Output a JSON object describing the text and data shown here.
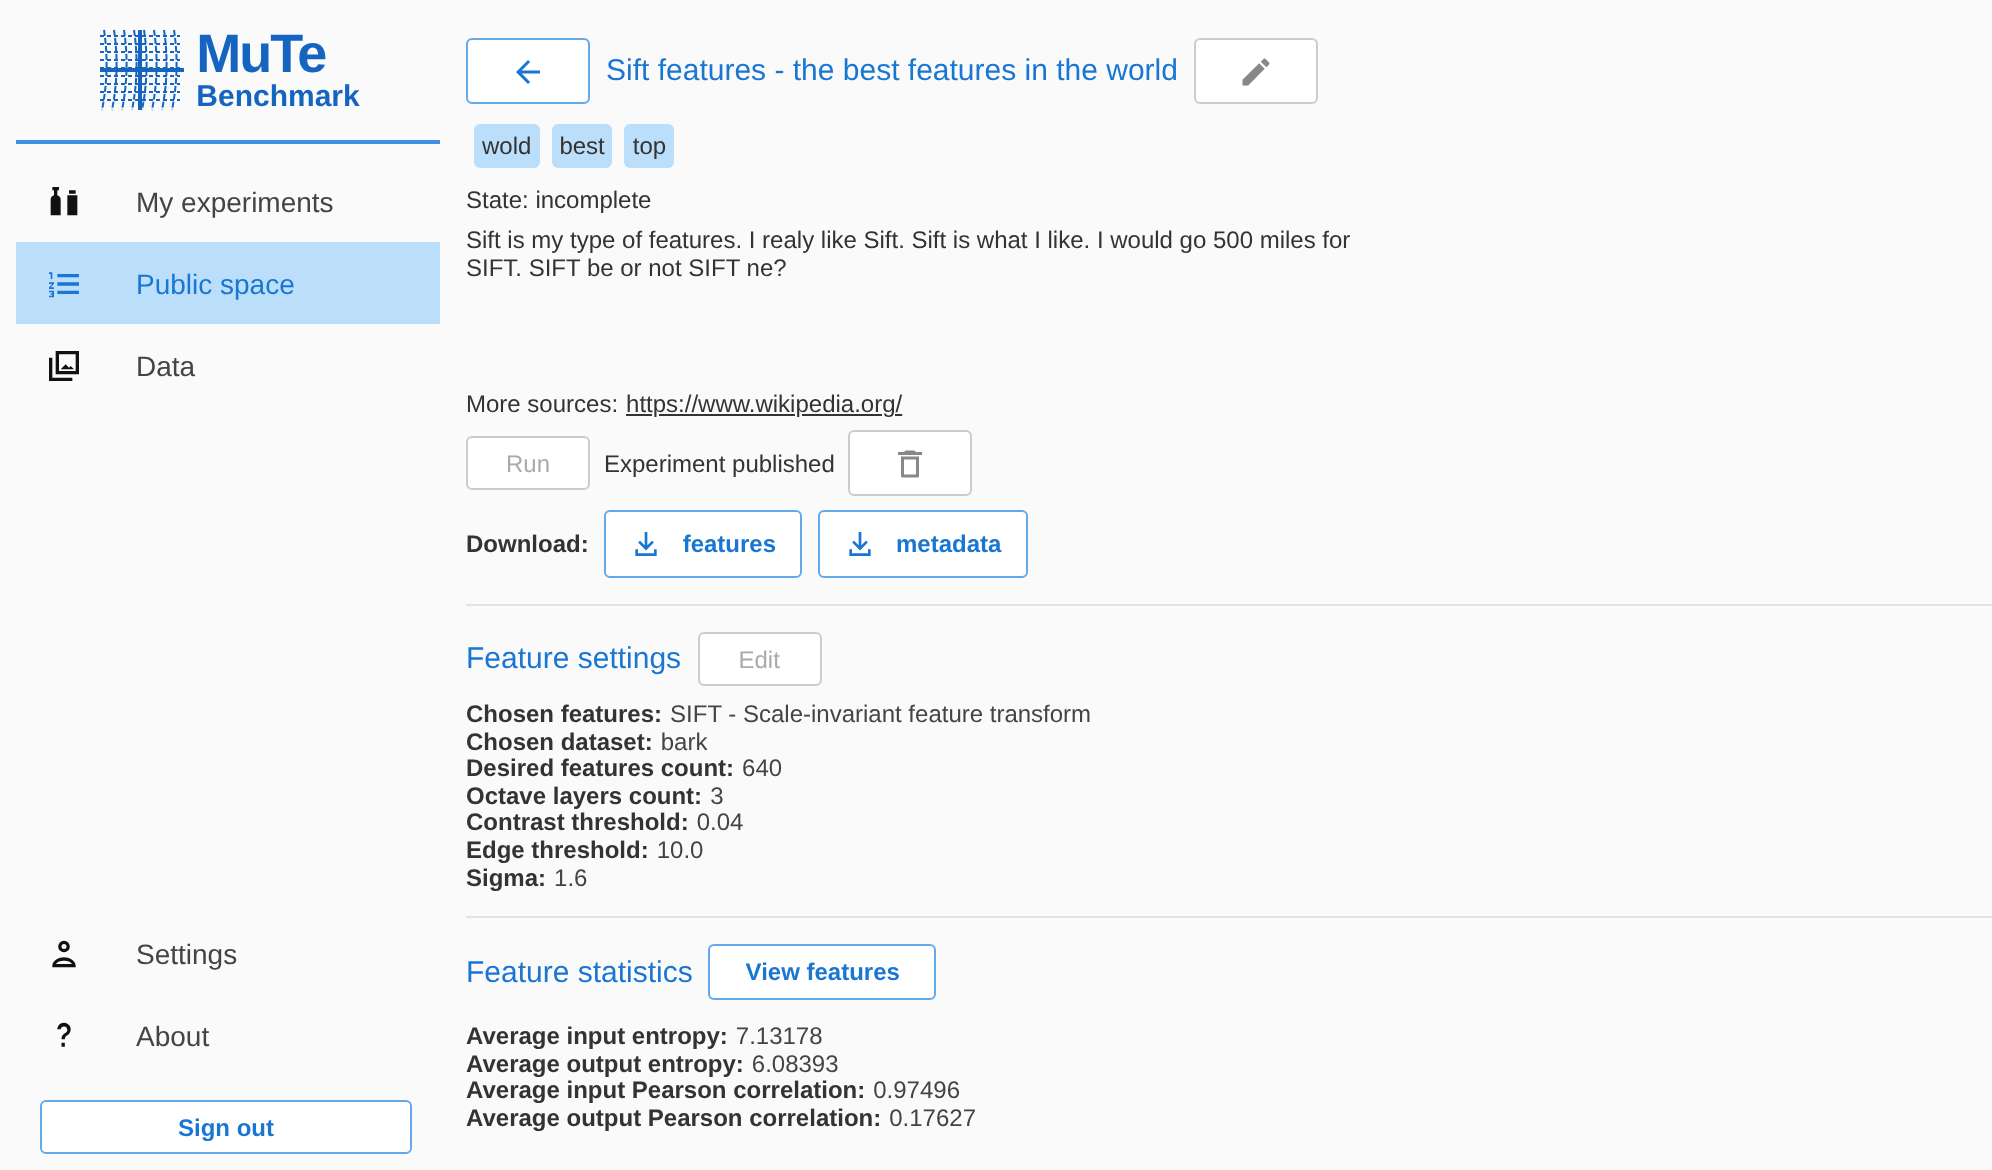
{
  "sidebar": {
    "logo": {
      "title": "MuTe",
      "subtitle": "Benchmark"
    },
    "items": [
      {
        "kind": "experiments",
        "label": "My experiments",
        "selected": false
      },
      {
        "kind": "list",
        "label": "Public space",
        "selected": true
      },
      {
        "kind": "images",
        "label": "Data",
        "selected": false
      }
    ],
    "bottom_items": [
      {
        "kind": "person",
        "label": "Settings",
        "selected": false
      },
      {
        "kind": "question",
        "label": "About",
        "selected": false
      }
    ],
    "sign_out": "Sign out"
  },
  "experiment": {
    "title": "Sift features - the best features in the world",
    "tags": [
      "wold",
      "best",
      "top"
    ],
    "state": "State: incomplete",
    "description": "Sift is my type of features. I realy like Sift. Sift is what I like. I would go 500 miles for SIFT. SIFT be or not SIFT ne?",
    "sources_label": "More sources:",
    "sources_link": "https://www.wikipedia.org/",
    "run": {
      "label": "Run",
      "disabled": true
    },
    "published": "Experiment published",
    "download_label": "Download:",
    "downloads": [
      "features",
      "metadata"
    ]
  },
  "feature_settings": {
    "title": "Feature settings",
    "edit": {
      "label": "Edit",
      "disabled": true
    },
    "properties": [
      {
        "label": "Chosen features:",
        "value": "SIFT - Scale-invariant feature transform"
      },
      {
        "label": "Chosen dataset:",
        "value": "bark"
      },
      {
        "label": "Desired features count:",
        "value": "640"
      },
      {
        "label": "Octave layers count:",
        "value": "3"
      },
      {
        "label": "Contrast threshold:",
        "value": "0.04"
      },
      {
        "label": "Edge threshold:",
        "value": "10.0"
      },
      {
        "label": "Sigma:",
        "value": "1.6"
      }
    ]
  },
  "feature_statistics": {
    "title": "Feature statistics",
    "button": "View features",
    "properties": [
      {
        "label": "Average input entropy:",
        "value": "7.13178"
      },
      {
        "label": "Average output entropy:",
        "value": "6.08393"
      },
      {
        "label": "Average input Pearson correlation:",
        "value": "0.97496"
      },
      {
        "label": "Average output Pearson correlation:",
        "value": "0.17627"
      }
    ]
  }
}
